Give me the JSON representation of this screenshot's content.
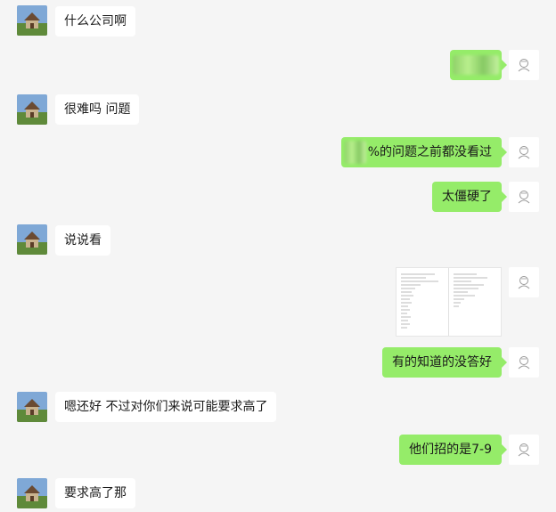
{
  "messages": [
    {
      "side": "in",
      "text": "什么公司啊"
    },
    {
      "side": "out",
      "text": ""
    },
    {
      "side": "in",
      "text": "很难吗 问题"
    },
    {
      "side": "out",
      "text": "%的问题之前都没看过"
    },
    {
      "side": "out",
      "text": "太僵硬了"
    },
    {
      "side": "in",
      "text": "说说看"
    },
    {
      "side": "out",
      "text": ""
    },
    {
      "side": "out",
      "text": "有的知道的没答好"
    },
    {
      "side": "in",
      "text": "嗯还好 不过对你们来说可能要求高了"
    },
    {
      "side": "out",
      "text": "他们招的是7-9"
    },
    {
      "side": "in",
      "text": "要求高了那"
    }
  ],
  "colors": {
    "background": "#f5f5f5",
    "incoming_bubble": "#ffffff",
    "outgoing_bubble": "#95ec69",
    "text": "#1a1a1a"
  },
  "icons": {
    "incoming_avatar": "house-landscape-avatar",
    "outgoing_avatar": "sketched-face-avatar"
  }
}
